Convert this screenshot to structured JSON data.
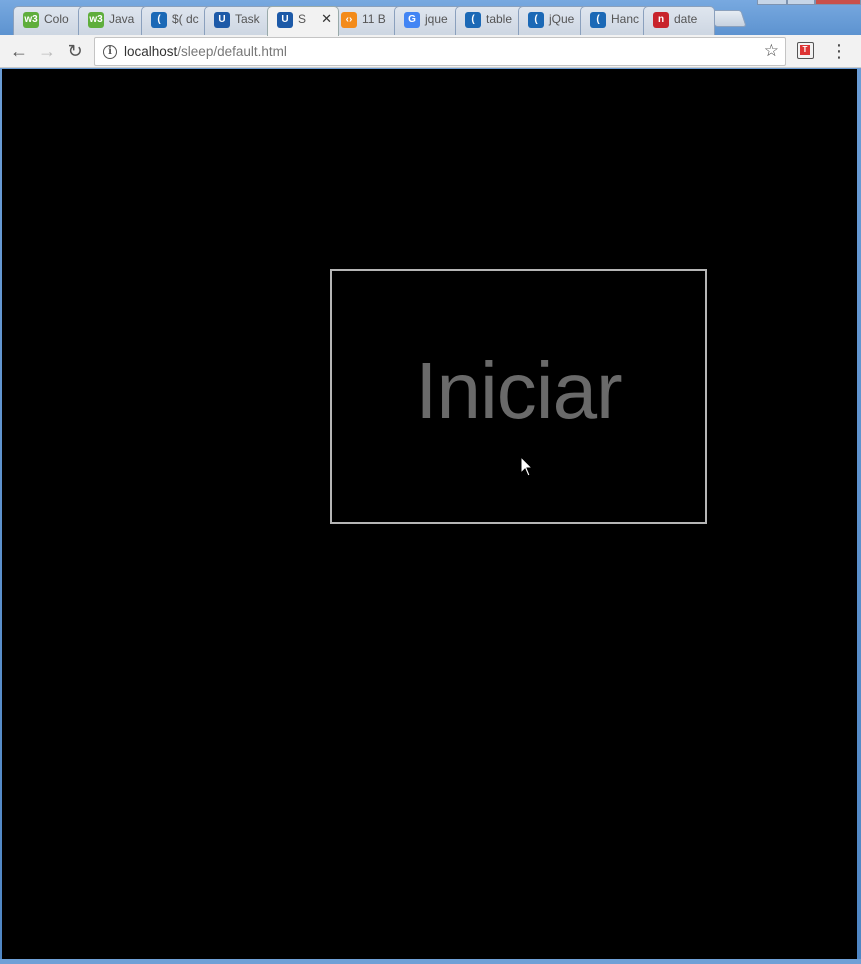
{
  "tabs": [
    {
      "label": "Colo",
      "favicon": "w3-icon",
      "color": "#5fae3c",
      "glyph": "w3"
    },
    {
      "label": "Java",
      "favicon": "w3-icon",
      "color": "#5fae3c",
      "glyph": "w3"
    },
    {
      "label": "$( dc",
      "favicon": "jquery-icon",
      "color": "#1b69b6",
      "glyph": "("
    },
    {
      "label": "Task",
      "favicon": "udemy-icon",
      "color": "#1d5aa8",
      "glyph": "U"
    },
    {
      "label": "S",
      "favicon": "udemy-icon",
      "color": "#1d5aa8",
      "glyph": "U",
      "active": true
    },
    {
      "label": "11 B",
      "favicon": "stack-icon",
      "color": "#f38b1a",
      "glyph": "‹›"
    },
    {
      "label": "jque",
      "favicon": "google-icon",
      "color": "#4285f4",
      "glyph": "G"
    },
    {
      "label": "table",
      "favicon": "jquery-icon",
      "color": "#1b69b6",
      "glyph": "("
    },
    {
      "label": "jQue",
      "favicon": "jquery-icon",
      "color": "#1b69b6",
      "glyph": "("
    },
    {
      "label": "Hanc",
      "favicon": "jquery-icon",
      "color": "#1b69b6",
      "glyph": "("
    },
    {
      "label": "date",
      "favicon": "nuget-icon",
      "color": "#c8242c",
      "glyph": "n"
    }
  ],
  "address": {
    "host": "localhost",
    "path": "/sleep/default.html"
  },
  "page": {
    "start_label": "Iniciar"
  },
  "colors": {
    "page_background": "#000000",
    "start_border": "#b5b5b5",
    "start_text": "#6a6a6a"
  }
}
